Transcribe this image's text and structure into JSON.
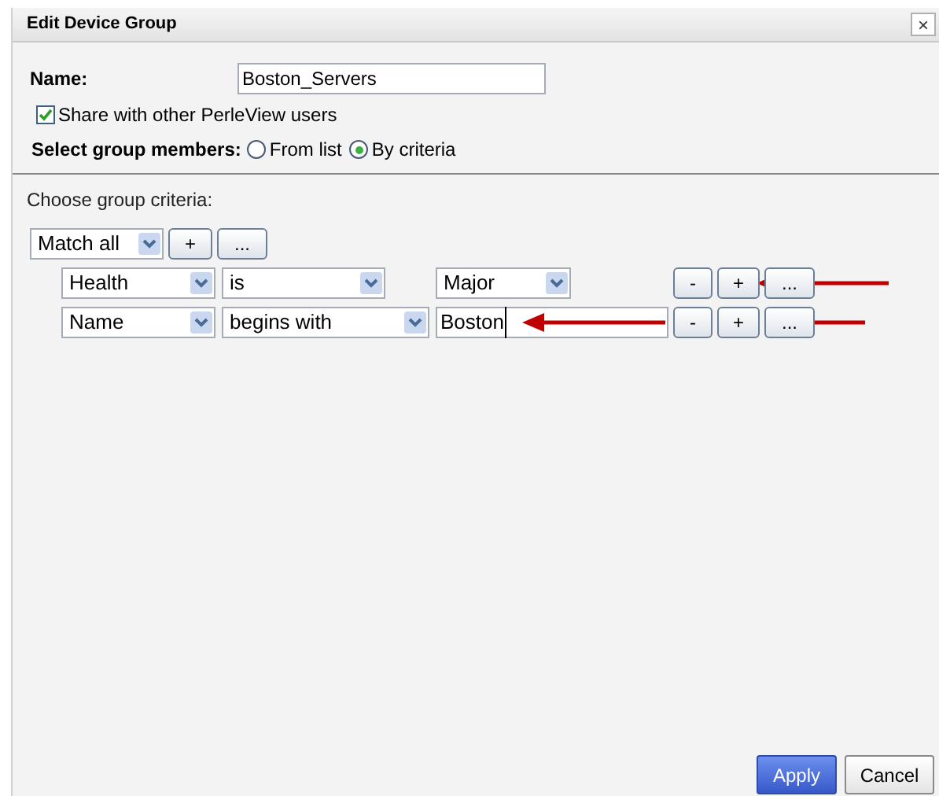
{
  "window": {
    "title": "Edit Device Group",
    "close": "×"
  },
  "name_field": {
    "label": "Name:",
    "value": "Boston_Servers"
  },
  "share": {
    "label": "Share with other PerleView users",
    "checked": true
  },
  "members": {
    "label": "Select group members:",
    "options": [
      {
        "label": "From list",
        "selected": false
      },
      {
        "label": "By criteria",
        "selected": true
      }
    ]
  },
  "criteria": {
    "label": "Choose group criteria:",
    "match": "Match all",
    "buttons": [
      "+",
      "..."
    ],
    "rows": [
      {
        "fields": [
          {
            "kind": "select",
            "value": "Health"
          },
          {
            "kind": "select",
            "value": "is"
          },
          {
            "kind": "select",
            "value": "Major"
          }
        ],
        "buttons": [
          "-",
          "+",
          "..."
        ]
      },
      {
        "fields": [
          {
            "kind": "select",
            "value": "Name"
          },
          {
            "kind": "select",
            "value": "begins with"
          },
          {
            "kind": "text",
            "value": "Boston"
          }
        ],
        "buttons": [
          "-",
          "+",
          "..."
        ]
      }
    ]
  },
  "buttons": [
    {
      "label": "Apply",
      "primary": true
    },
    {
      "label": "Cancel",
      "primary": false
    }
  ]
}
